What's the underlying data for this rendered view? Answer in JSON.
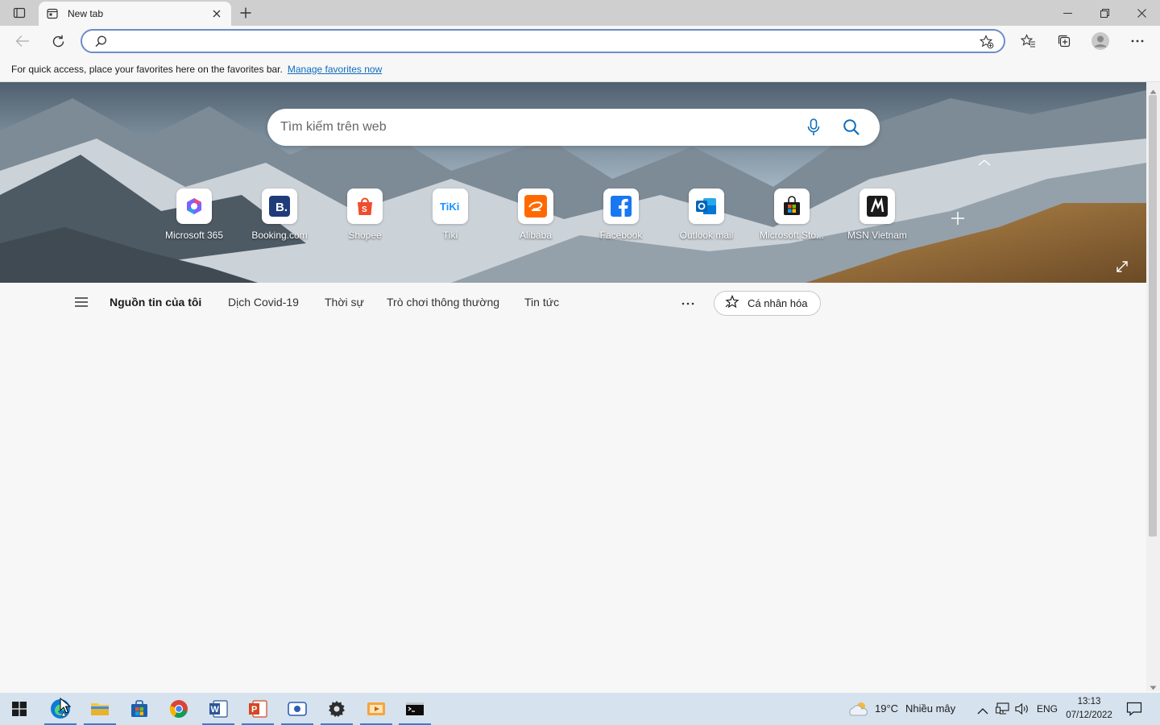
{
  "browser": {
    "tab_title": "New tab",
    "address_value": "",
    "favorites_bar_message": "For quick access, place your favorites here on the favorites bar.",
    "favorites_bar_link": "Manage favorites now"
  },
  "newtab": {
    "search_placeholder": "Tìm kiếm trên web",
    "tiles": [
      {
        "label": "Microsoft 365",
        "icon": "microsoft-365-icon"
      },
      {
        "label": "Booking.com",
        "icon": "booking-icon"
      },
      {
        "label": "Shopee",
        "icon": "shopee-icon"
      },
      {
        "label": "Tiki",
        "icon": "tiki-icon"
      },
      {
        "label": "Alibaba",
        "icon": "alibaba-icon"
      },
      {
        "label": "Facebook",
        "icon": "facebook-icon"
      },
      {
        "label": "Outlook mail",
        "icon": "outlook-icon"
      },
      {
        "label": "Microsoft Sto...",
        "icon": "microsoft-store-icon"
      },
      {
        "label": "MSN Vietnam",
        "icon": "msn-icon"
      }
    ],
    "feed_nav": {
      "items": [
        "Nguồn tin của tôi",
        "Dịch Covid-19",
        "Thời sự",
        "Trò chơi thông thường",
        "Tin tức"
      ],
      "personalize_label": "Cá nhân hóa"
    }
  },
  "taskbar": {
    "weather_temp": "19°C",
    "weather_desc": "Nhiều mây",
    "language": "ENG",
    "time": "13:13",
    "date": "07/12/2022"
  },
  "colors": {
    "accent": "#0f6cbd",
    "address_border": "#6d8dc7",
    "taskbar": "#d6e2ee"
  }
}
